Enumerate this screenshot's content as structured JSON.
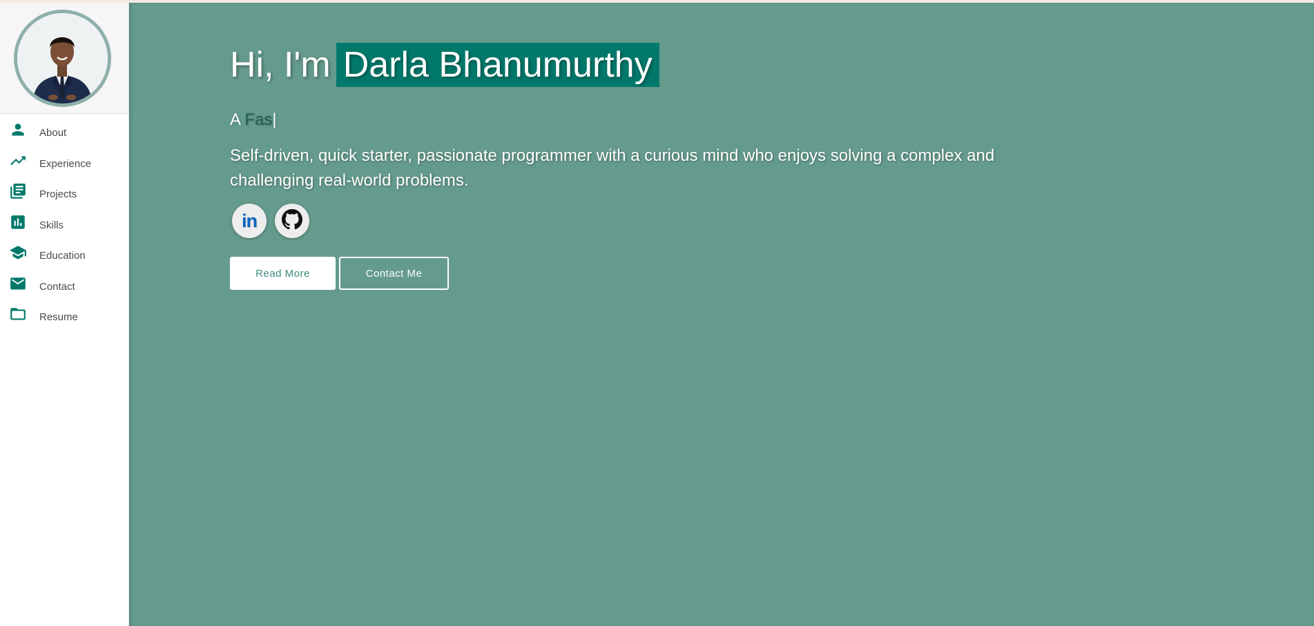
{
  "hero": {
    "greeting": "Hi, I'm",
    "name": "Darla Bhanumurthy",
    "role_prefix": "A",
    "role_typed": "Fas",
    "caret": "|",
    "tagline": "Self-driven, quick starter, passionate programmer with a curious mind who enjoys solving a complex and challenging real-world problems.",
    "read_more_label": "Read More",
    "contact_label": "Contact Me"
  },
  "sidebar": {
    "items": [
      {
        "label": "About",
        "icon": "person-icon"
      },
      {
        "label": "Experience",
        "icon": "trending-up-icon"
      },
      {
        "label": "Projects",
        "icon": "library-books-icon"
      },
      {
        "label": "Skills",
        "icon": "bar-chart-icon"
      },
      {
        "label": "Education",
        "icon": "school-icon"
      },
      {
        "label": "Contact",
        "icon": "mail-icon"
      },
      {
        "label": "Resume",
        "icon": "folder-icon"
      }
    ]
  },
  "socials": {
    "linkedin_label": "in",
    "icons": [
      "linkedin-icon",
      "github-icon"
    ]
  },
  "colors": {
    "accent": "#00796b",
    "hero_bg": "#659b8d",
    "icon": "#00796b"
  }
}
